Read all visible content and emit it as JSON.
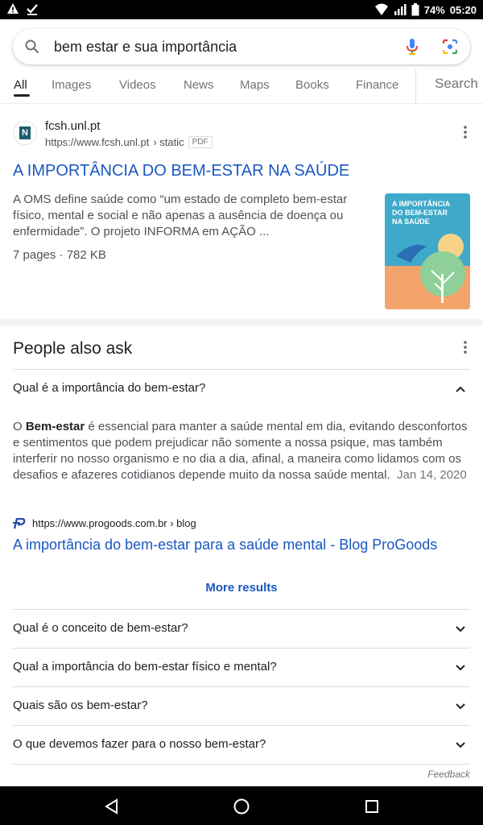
{
  "status_bar": {
    "battery": "74%",
    "time": "05:20"
  },
  "search": {
    "query": "bem estar e sua importância"
  },
  "tabs": [
    "All",
    "Images",
    "Videos",
    "News",
    "Maps",
    "Books",
    "Finance",
    "Search"
  ],
  "result": {
    "favicon_letter": "N",
    "site_name": "fcsh.unl.pt",
    "url": "https://www.fcsh.unl.pt",
    "path": "› static",
    "badge": "PDF",
    "title": "A IMPORTÂNCIA DO BEM-ESTAR NA SAÚDE",
    "snippet": "A OMS define saúde como “um estado de completo bem-estar físico, mental e social e não apenas a ausência de doença ou enfermidade”. O projeto INFORMA em AÇÃO ...",
    "meta": "7 pages · 782 KB",
    "thumbnail_text": [
      "A IMPORTÂNCIA",
      "DO BEM-ESTAR",
      "NA SAÚDE"
    ]
  },
  "people_also_ask": {
    "title": "People also ask",
    "expanded": {
      "question": "Qual é a importância do bem-estar?",
      "answer_prefix": "O ",
      "answer_bold": "Bem-estar",
      "answer_rest": " é essencial para manter a saúde mental em dia, evitando desconfortos e sentimentos que podem prejudicar não somente a nossa psique, mas também interferir no nosso organismo e no dia a dia, afinal, a maneira como lidamos com os desafios e afazeres cotidianos depende muito da nossa saúde mental.",
      "date": "Jan 14, 2020",
      "source_url": "https://www.progoods.com.br › blog",
      "source_title": "A importância do bem-estar para a saúde mental - Blog ProGoods",
      "more_label": "More results"
    },
    "questions": [
      "Qual é o conceito de bem-estar?",
      "Qual a importância do bem-estar físico e mental?",
      "Quais são os bem-estar?",
      "O que devemos fazer para o nosso bem-estar?"
    ]
  },
  "feedback_label": "Feedback",
  "colors": {
    "link": "#1a57c2",
    "text": "#202124",
    "secondary": "#4d5156",
    "accent_google_blue": "#4285f4"
  }
}
